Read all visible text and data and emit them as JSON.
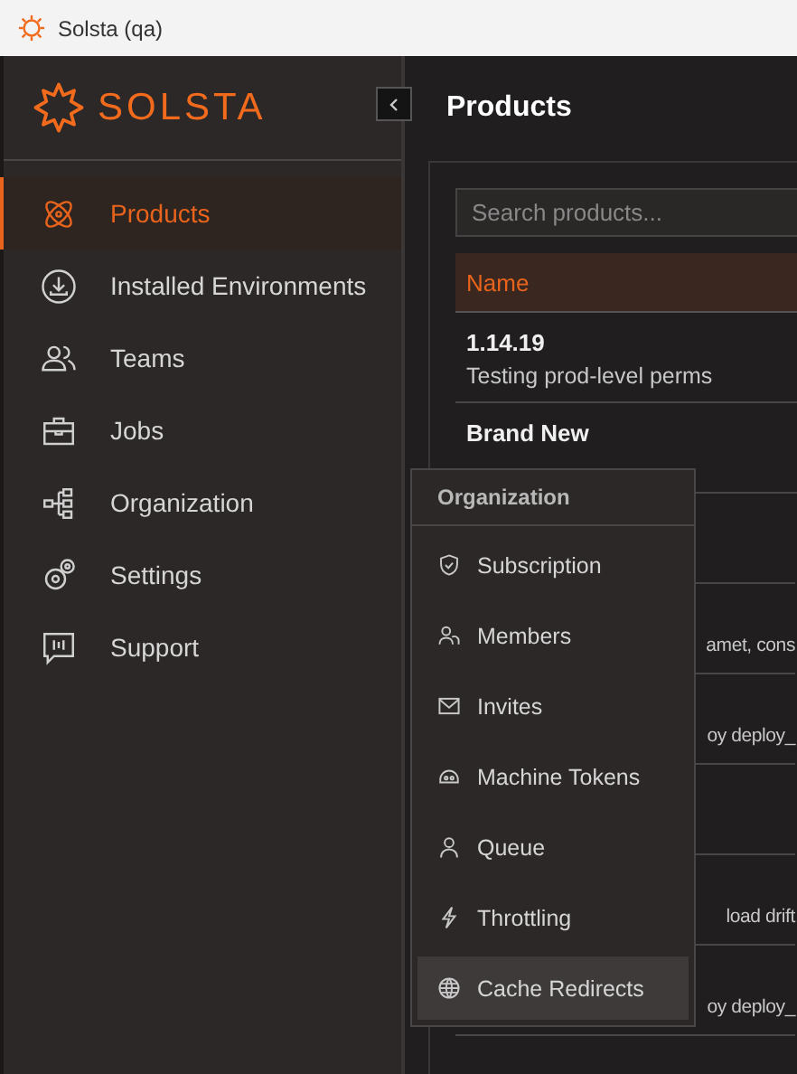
{
  "window": {
    "title": "Solsta (qa)"
  },
  "brand": "SOLSTA",
  "sidebar": {
    "items": [
      {
        "label": "Products",
        "selected": true
      },
      {
        "label": "Installed Environments",
        "selected": false
      },
      {
        "label": "Teams",
        "selected": false
      },
      {
        "label": "Jobs",
        "selected": false
      },
      {
        "label": "Organization",
        "selected": false
      },
      {
        "label": "Settings",
        "selected": false
      },
      {
        "label": "Support",
        "selected": false
      }
    ]
  },
  "page": {
    "title": "Products",
    "search": {
      "placeholder": "Search products..."
    },
    "table": {
      "columns": [
        "Name"
      ],
      "rows": [
        {
          "name": "1.14.19",
          "description": "Testing prod-level perms"
        },
        {
          "name": "Brand New"
        },
        {},
        {
          "description": "amet, cons"
        },
        {
          "description": "oy deploy_"
        },
        {},
        {
          "description": "load drift"
        },
        {
          "description": "oy deploy_"
        }
      ]
    }
  },
  "menu": {
    "title": "Organization",
    "items": [
      {
        "label": "Subscription",
        "selected": false
      },
      {
        "label": "Members",
        "selected": false
      },
      {
        "label": "Invites",
        "selected": false
      },
      {
        "label": "Machine Tokens",
        "selected": false
      },
      {
        "label": "Queue",
        "selected": false
      },
      {
        "label": "Throttling",
        "selected": false
      },
      {
        "label": "Cache Redirects",
        "selected": true
      }
    ]
  }
}
